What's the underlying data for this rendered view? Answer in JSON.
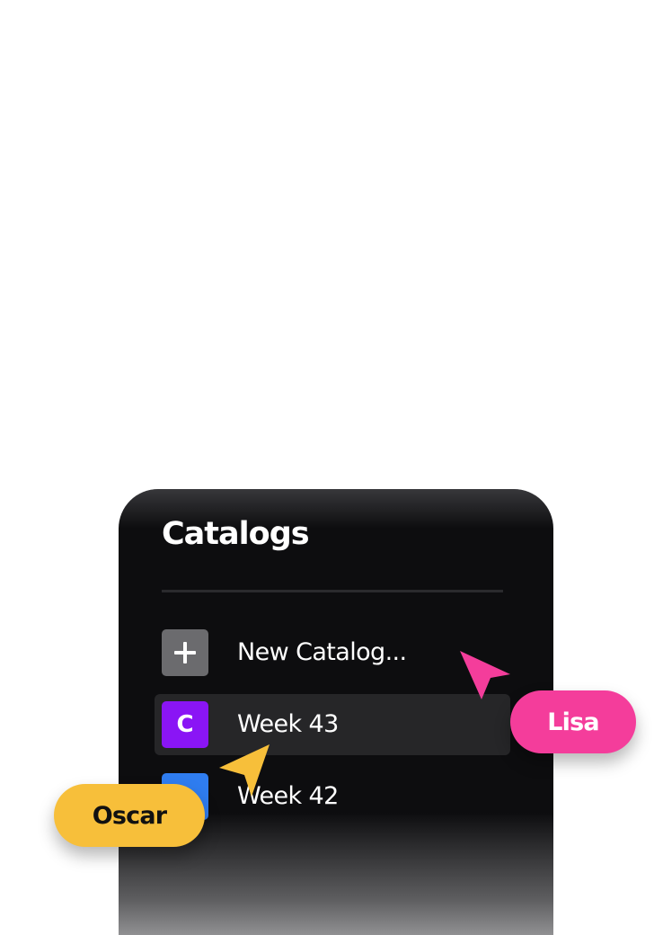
{
  "catalogs": {
    "title": "Catalogs",
    "items": [
      {
        "label": "New Catalog...",
        "icon": "plus-icon",
        "icon_glyph": "+",
        "icon_color": "#6b6b6e",
        "active": false
      },
      {
        "label": "Week 43",
        "icon": "catalog-letter-icon",
        "icon_glyph": "C",
        "icon_color": "#8a15f5",
        "active": true
      },
      {
        "label": "Week 42",
        "icon": "catalog-letter-icon",
        "icon_glyph": "",
        "icon_color": "#2f7df0",
        "active": false
      }
    ]
  },
  "collaborators": [
    {
      "name": "Lisa",
      "color": "#f43d9b",
      "text_color": "#ffffff"
    },
    {
      "name": "Oscar",
      "color": "#f7bf3a",
      "text_color": "#111111"
    }
  ]
}
